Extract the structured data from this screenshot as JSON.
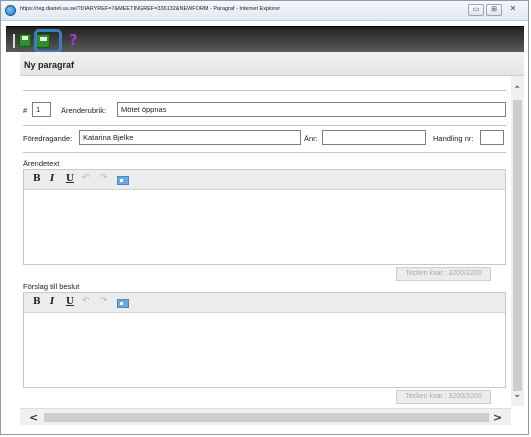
{
  "window": {
    "title": "https://reg.diariet.uu.se/?DIARYREF=7&MEETINGREF=336132&NEWFORM - Paragraf - Internet Explorer",
    "minimize_glyph": "▭",
    "maximize_glyph": "⊞",
    "close_glyph": "✕"
  },
  "toolbar": {
    "help_glyph": "?",
    "icons": [
      "save-icon",
      "save-and-close-icon",
      "help-icon"
    ]
  },
  "form": {
    "title": "Ny paragraf",
    "number_label": "#",
    "number_value": "1",
    "subject_label": "Ärenderubrik:",
    "subject_value": "Mötet öppnas",
    "presenter_label": "Föredragande:",
    "presenter_value": "Katarina Bjelke",
    "anr_label": "Änr:",
    "anr_value": "",
    "document_label": "Handling nr:",
    "document_value": ""
  },
  "case_text": {
    "label": "Ärendetext",
    "counter": "Tecken kvar : 3200/3200"
  },
  "decision": {
    "label": "Förslag till beslut",
    "counter": "Tecken kvar : 3200/3200"
  },
  "editor_toolbar": {
    "bold": "B",
    "italic": "I",
    "underline": "U",
    "undo": "↶",
    "redo": "↷"
  },
  "scrollbars": {
    "up": "⌃",
    "down": "⌄",
    "left": "<",
    "right": ">"
  },
  "colors": {
    "toolbar_dark": "#2b2b2b",
    "highlight_box": "#3a7ebf",
    "help_purple": "#9b3bd1",
    "save_green": "#2e8e2a"
  }
}
